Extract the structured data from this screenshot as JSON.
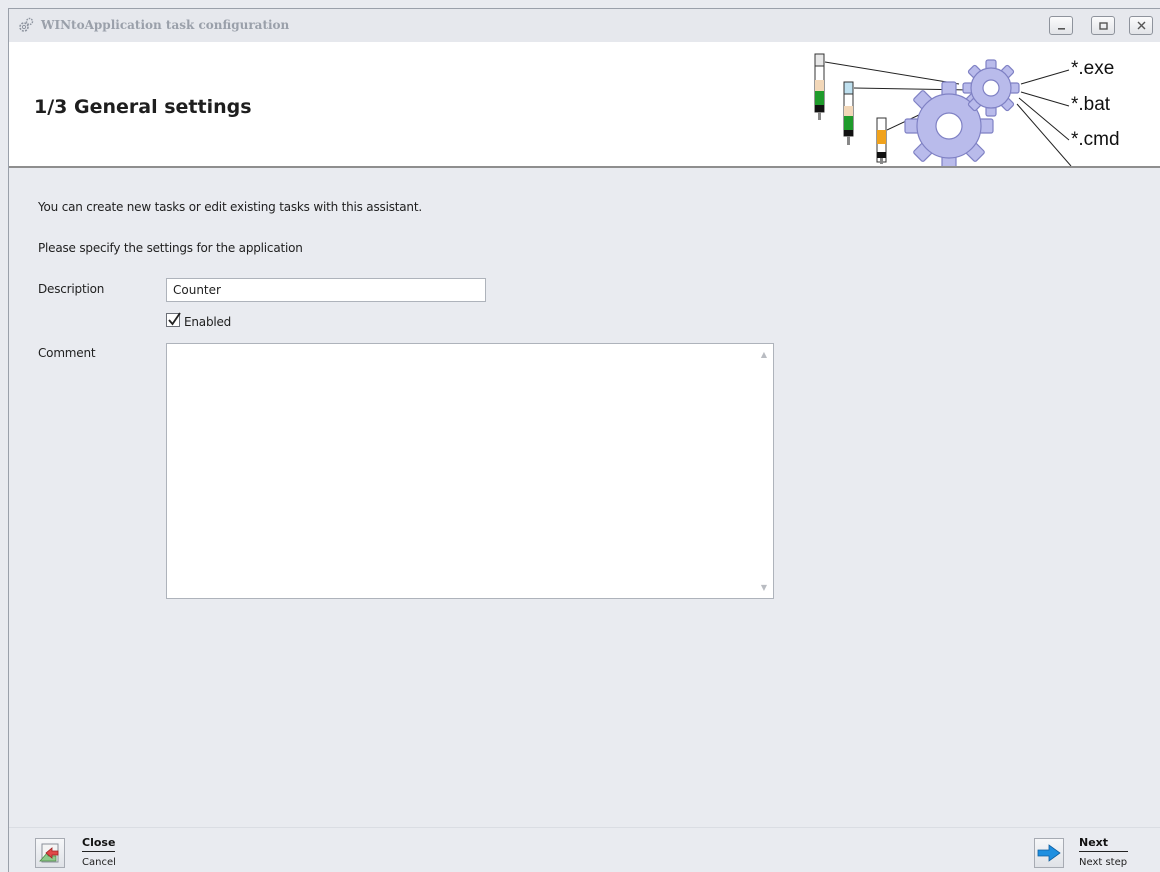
{
  "window": {
    "title": "WINtoApplication task configuration"
  },
  "header": {
    "title": "1/3 General settings",
    "illustration_labels": [
      "*.exe",
      "*.bat",
      "*.cmd",
      "..."
    ]
  },
  "content": {
    "intro": "You can create new tasks or edit existing tasks with this assistant.",
    "instructions": "Please specify the settings for the application",
    "description_label": "Description",
    "description_value": "Counter",
    "enabled_label": "Enabled",
    "enabled_checked": true,
    "comment_label": "Comment",
    "comment_value": ""
  },
  "footer": {
    "close_label": "Close",
    "close_sub": "Cancel",
    "next_label": "Next",
    "next_sub": "Next step"
  },
  "colors": {
    "background": "#e9ebf0",
    "header_bg": "#ffffff",
    "gear": "#b8b9e8",
    "arrow_blue": "#1e8fe0"
  },
  "icons": {
    "title": "gears-icon",
    "close": "close-wizard-icon",
    "next": "arrow-right-icon"
  }
}
